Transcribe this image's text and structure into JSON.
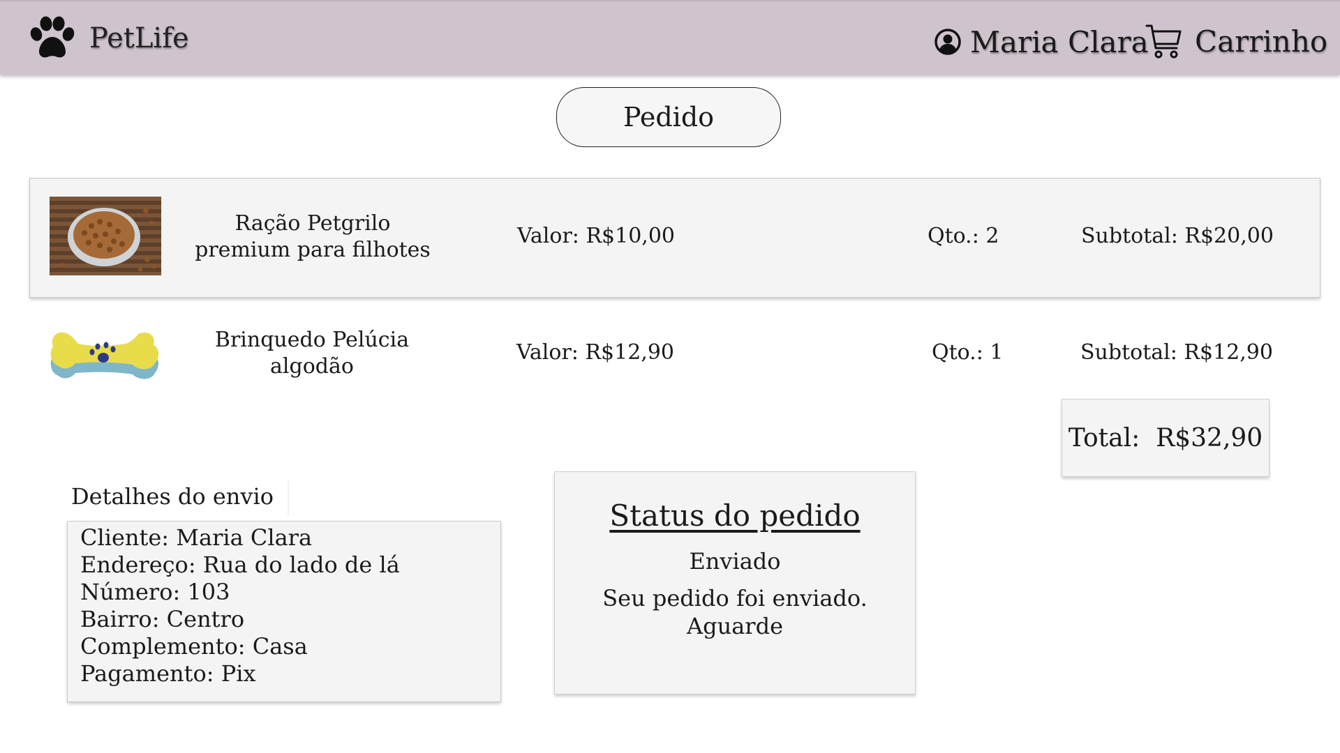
{
  "header": {
    "brand": "PetLife",
    "user_name": "Maria Clara",
    "cart_label": "Carrinho",
    "bg_color": "#cfc4ce"
  },
  "order_button": "Pedido",
  "items": [
    {
      "name_line1": "Ração Petgrilo",
      "name_line2": "premium para filhotes",
      "price": "Valor: R$10,00",
      "qty": "Qto.: 2",
      "subtotal": "Subtotal: R$20,00",
      "image": "dog-food-bowl"
    },
    {
      "name_line1": "Brinquedo Pelúcia",
      "name_line2": "algodão",
      "price": "Valor: R$12,90",
      "qty": "Qto.: 1",
      "subtotal": "Subtotal: R$12,90",
      "image": "plush-bone-toy"
    }
  ],
  "total": "Total:  R$32,90",
  "shipping": {
    "title": "Detalhes do envio",
    "lines": [
      "Cliente: Maria Clara",
      "Endereço: Rua do lado de lá",
      "Número: 103",
      "Bairro: Centro",
      "Complemento: Casa",
      "Pagamento: Pix"
    ]
  },
  "status": {
    "title": "Status do pedido",
    "state": "Enviado",
    "message_line1": "Seu pedido foi enviado.",
    "message_line2": "Aguarde"
  }
}
